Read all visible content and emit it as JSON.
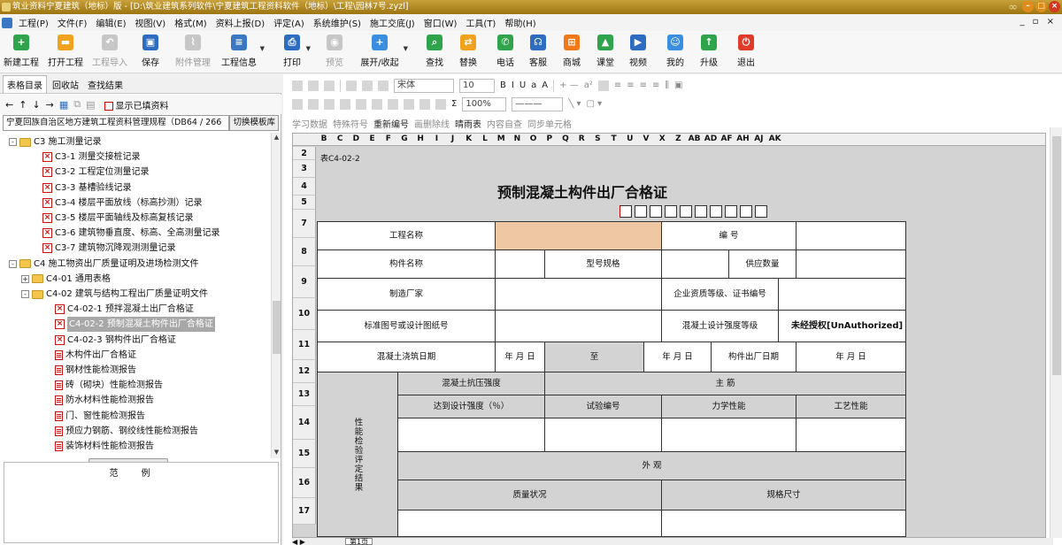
{
  "window": {
    "title": "筑业资料宁夏建筑（地标）版 - [D:\\筑业建筑系列软件\\宁夏建筑工程资料软件（地标）\\工程\\园林7号.zyzl]"
  },
  "menu": [
    "工程(P)",
    "文件(F)",
    "编辑(E)",
    "视图(V)",
    "格式(M)",
    "资料上报(D)",
    "评定(A)",
    "系统维护(S)",
    "施工交底(J)",
    "窗口(W)",
    "工具(T)",
    "帮助(H)"
  ],
  "toolbar": {
    "new_project": "新建工程",
    "open_project": "打开工程",
    "import_project": "工程导入",
    "save": "保存",
    "attachments": "附件管理",
    "project_info": "工程信息",
    "print": "打印",
    "preview": "预览",
    "expand_collapse": "展开/收起",
    "find": "查找",
    "replace": "替换",
    "phone": "电话",
    "service": "客服",
    "mall": "商城",
    "classroom": "课堂",
    "video": "视频",
    "mine": "我的",
    "upgrade": "升级",
    "exit": "退出"
  },
  "colors": {
    "title_bar": "#b08b22",
    "accent": "#3b78c4",
    "peach_cell": "#efc7a3",
    "selected_row": "#a8a8a8"
  },
  "left": {
    "tabs": [
      "表格目录",
      "回收站",
      "查找结果"
    ],
    "show_filled": "显示已填资料",
    "standard": "宁夏回族自治区地方建筑工程资料管理规程（DB64 / 266",
    "switch_template": "切换模板库",
    "tree": [
      {
        "label": "C3 施工测量记录",
        "type": "folder",
        "lvl": 1,
        "exp": "-"
      },
      {
        "label": "C3-1 测量交接桩记录",
        "type": "x",
        "lvl": 3
      },
      {
        "label": "C3-2 工程定位测量记录",
        "type": "x",
        "lvl": 3
      },
      {
        "label": "C3-3 基槽验线记录",
        "type": "x",
        "lvl": 3
      },
      {
        "label": "C3-4 楼层平面放线（标高抄测）记录",
        "type": "x",
        "lvl": 3
      },
      {
        "label": "C3-5 楼层平面轴线及标高复核记录",
        "type": "x",
        "lvl": 3
      },
      {
        "label": "C3-6 建筑物垂直度、标高、全高测量记录",
        "type": "x",
        "lvl": 3
      },
      {
        "label": "C3-7 建筑物沉降观测测量记录",
        "type": "x",
        "lvl": 3
      },
      {
        "label": "C4 施工物资出厂质量证明及进场检测文件",
        "type": "folder",
        "lvl": 1,
        "exp": "-"
      },
      {
        "label": "C4-01 通用表格",
        "type": "folder",
        "lvl": 2,
        "exp": "+"
      },
      {
        "label": "C4-02 建筑与结构工程出厂质量证明文件",
        "type": "folder",
        "lvl": 2,
        "exp": "-"
      },
      {
        "label": "C4-02-1 预拌混凝土出厂合格证",
        "type": "x",
        "lvl": 4
      },
      {
        "label": "C4-02-2 预制混凝土构件出厂合格证",
        "type": "x",
        "lvl": 4,
        "sel": true
      },
      {
        "label": "C4-02-3 钢构件出厂合格证",
        "type": "x",
        "lvl": 4
      },
      {
        "label": "木构件出厂合格证",
        "type": "d",
        "lvl": 4
      },
      {
        "label": "钢材性能检测报告",
        "type": "d",
        "lvl": 4
      },
      {
        "label": "砖（砌块）性能检测报告",
        "type": "d",
        "lvl": 4
      },
      {
        "label": "防水材料性能检测报告",
        "type": "d",
        "lvl": 4
      },
      {
        "label": "门、窗性能检测报告",
        "type": "d",
        "lvl": 4
      },
      {
        "label": "预应力钢筋、钢绞线性能检测报告",
        "type": "d",
        "lvl": 4
      },
      {
        "label": "装饰材料性能检测报告",
        "type": "d",
        "lvl": 4
      }
    ],
    "example_title": "范例"
  },
  "format": {
    "font": "宋体",
    "size": "10",
    "zoom": "100%",
    "row3": [
      "学习数据",
      "特殊符号",
      "重新编号",
      "画删除线",
      "晴雨表",
      "内容自查",
      "同步单元格"
    ]
  },
  "sheet": {
    "columns": [
      "B",
      "C",
      "D",
      "E",
      "F",
      "G",
      "H",
      "I",
      "J",
      "K",
      "L",
      "M",
      "N",
      "O",
      "P",
      "Q",
      "R",
      "S",
      "T",
      "U",
      "V",
      "X",
      "Z",
      "AB",
      "AD",
      "AF",
      "AH",
      "AJ",
      "AK"
    ],
    "rows": [
      "2",
      "3",
      "4",
      "5",
      "7",
      "8",
      "9",
      "10",
      "11",
      "12",
      "13",
      "14",
      "15",
      "16",
      "17"
    ],
    "tab": "第1页"
  },
  "form": {
    "number": "表C4-02-2",
    "title": "预制混凝土构件出厂合格证",
    "project_name": "工程名称",
    "code": "编 号",
    "component_name": "构件名称",
    "model_spec": "型号规格",
    "supply_qty": "供应数量",
    "manufacturer": "制造厂家",
    "qualification": "企业资质等级、证书编号",
    "drawing_no": "标准图号或设计图纸号",
    "design_strength": "混凝土设计强度等级",
    "unauthorized": "未经授权[UnAuthorized]",
    "pour_date": "混凝土浇筑日期",
    "ymd": "年 月 日",
    "to": "至",
    "ex_date": "构件出厂日期",
    "perf_label": "性能检验评定结果",
    "compressive": "混凝土抗压强度",
    "rebar": "主 筋",
    "reach_design": "达到设计强度（％）",
    "test_no": "试验编号",
    "mech": "力学性能",
    "process": "工艺性能",
    "appearance": "外 观",
    "quality_state": "质量状况",
    "spec_size": "规格尺寸"
  }
}
